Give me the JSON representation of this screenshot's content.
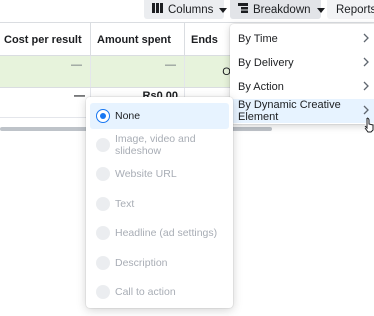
{
  "toolbar": {
    "columns_label": "Columns",
    "breakdown_label": "Breakdown",
    "reports_label": "Reports",
    "columns_icon": "columns-icon",
    "breakdown_icon": "breakdown-icon"
  },
  "table": {
    "headers": [
      "Cost per result",
      "Amount spent",
      "Ends"
    ],
    "rows": [
      {
        "cost_per_result": "—",
        "amount_spent": "—",
        "ends": "Ong"
      },
      {
        "cost_per_result": "—",
        "amount_spent": "Rs0.00"
      }
    ]
  },
  "breakdown_menu": {
    "items": [
      {
        "label": "By Time"
      },
      {
        "label": "By Delivery"
      },
      {
        "label": "By Action"
      },
      {
        "label": "By Dynamic Creative Element"
      }
    ]
  },
  "submenu": {
    "items": [
      {
        "label": "None",
        "selected": true
      },
      {
        "label": "Image, video and slideshow",
        "selected": false
      },
      {
        "label": "Website URL",
        "selected": false
      },
      {
        "label": "Text",
        "selected": false
      },
      {
        "label": "Headline (ad settings)",
        "selected": false
      },
      {
        "label": "Description",
        "selected": false
      },
      {
        "label": "Call to action",
        "selected": false
      }
    ]
  },
  "colors": {
    "accent": "#1877f2",
    "highlight": "#e7f3ff",
    "row_highlight": "#e7f3dc",
    "disabled_text": "#a8adb5"
  }
}
